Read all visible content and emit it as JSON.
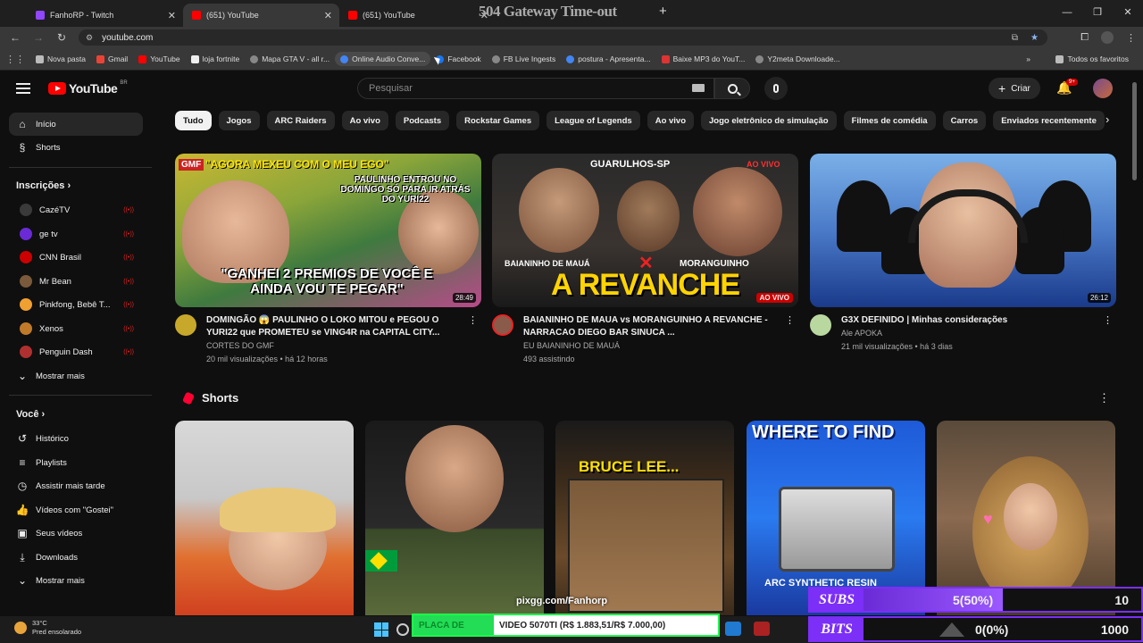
{
  "browser": {
    "tabs": [
      {
        "title": "FanhoRP - Twitch",
        "color": "#9146ff"
      },
      {
        "title": "(651) YouTube",
        "color": "#ff0000"
      },
      {
        "title": "(651) YouTube",
        "color": "#ff0000"
      }
    ],
    "overlay_title": "504 Gateway Time-out",
    "url": "youtube.com",
    "bookmarks": [
      {
        "label": "Nova pasta",
        "icon": "folder-icon"
      },
      {
        "label": "Gmail",
        "icon": "gmail-icon"
      },
      {
        "label": "YouTube",
        "icon": "youtube-icon"
      },
      {
        "label": "loja fortnite",
        "icon": "fortnite-icon"
      },
      {
        "label": "Mapa GTA V - all r...",
        "icon": "globe-icon"
      },
      {
        "label": "Online Audio Conve...",
        "icon": "audio-icon"
      },
      {
        "label": "Facebook",
        "icon": "facebook-icon"
      },
      {
        "label": "FB Live Ingests",
        "icon": "globe-icon"
      },
      {
        "label": "postura - Apresenta...",
        "icon": "slides-icon"
      },
      {
        "label": "Baixe MP3 do YouT...",
        "icon": "download-icon"
      },
      {
        "label": "Y2meta Downloade...",
        "icon": "globe-icon"
      }
    ],
    "all_bookmarks": "Todos os favoritos"
  },
  "yt": {
    "logo_country": "BR",
    "search_placeholder": "Pesquisar",
    "create_label": "Criar",
    "notif_count": "9+"
  },
  "sidebar": {
    "main": [
      {
        "label": "Início",
        "icon": "home-icon"
      },
      {
        "label": "Shorts",
        "icon": "shorts-icon"
      }
    ],
    "subs_heading": "Inscrições",
    "subs": [
      {
        "label": "CazéTV",
        "color": "#3a3a3a"
      },
      {
        "label": "ge tv",
        "color": "#6a2bd6"
      },
      {
        "label": "CNN Brasil",
        "color": "#cc0000"
      },
      {
        "label": "Mr Bean",
        "color": "#7a5a3a"
      },
      {
        "label": "Pinkfong, Bebê T...",
        "color": "#f0a030"
      },
      {
        "label": "Xenos",
        "color": "#c07a2a"
      },
      {
        "label": "Penguin Dash",
        "color": "#b03030"
      }
    ],
    "subs_more": "Mostrar mais",
    "you_heading": "Você",
    "you": [
      {
        "label": "Histórico",
        "icon": "history-icon"
      },
      {
        "label": "Playlists",
        "icon": "playlist-icon"
      },
      {
        "label": "Assistir mais tarde",
        "icon": "clock-icon"
      },
      {
        "label": "Vídeos com \"Gostei\"",
        "icon": "like-icon"
      },
      {
        "label": "Seus vídeos",
        "icon": "video-icon"
      },
      {
        "label": "Downloads",
        "icon": "download-icon"
      }
    ],
    "you_more": "Mostrar mais"
  },
  "chips": [
    "Tudo",
    "Jogos",
    "ARC Raiders",
    "Ao vivo",
    "Podcasts",
    "Rockstar Games",
    "League of Legends",
    "Ao vivo",
    "Jogo eletrônico de simulação",
    "Filmes de comédia",
    "Carros",
    "Enviados recentemente"
  ],
  "videos": [
    {
      "title": "DOMINGÃO 😱 PAULINHO O LOKO MITOU e PEGOU O YURI22 que PROMETEU se VING4R na CAPITAL CITY...",
      "channel": "CORTES DO GMF",
      "stats": "20 mil visualizações • há 12 horas",
      "badge": "28:49",
      "thumb_top": "\"AGORA MEXEU COM O MEU EGO\"",
      "thumb_mid": "PAULINHO ENTROU NO DOMINGO SÓ PARA IR ATRÁS DO YURI22",
      "thumb_bottom": "\"GANHEI 2 PREMIOS DE VOCÊ E AINDA VOU TE PEGAR\"",
      "thumb_logo": "GMF"
    },
    {
      "title": "BAIANINHO DE MAUA vs MORANGUINHO A REVANCHE -NARRACAO DIEGO BAR SINUCA ...",
      "channel": "EU BAIANINHO DE MAUÁ",
      "stats": "493 assistindo",
      "badge": "AO VIVO",
      "thumb_top": "GUARULHOS-SP",
      "thumb_live": "AO VIVO",
      "thumb_left": "BAIANINHO DE MAUÁ",
      "thumb_right": "MORANGUINHO",
      "thumb_big": "A REVANCHE"
    },
    {
      "title": "G3X DEFINIDO | Minhas considerações",
      "channel": "Ale APOKA",
      "stats": "21 mil visualizações • há 3 dias",
      "badge": "26:12"
    }
  ],
  "shorts": {
    "heading": "Shorts",
    "items": [
      {
        "overlay": ""
      },
      {
        "overlay": ""
      },
      {
        "overlay": "BRUCE LEE..."
      },
      {
        "overlay": "WHERE TO FIND",
        "sub": "ARC SYNTHETIC RESIN"
      },
      {
        "overlay": ""
      }
    ]
  },
  "stream_overlay": {
    "pix": "pixgg.com/Fanhorp",
    "ticker_label": "PLACA DE",
    "ticker_text": "VIDEO 5070TI (R$ 1.883,51/R$ 7.000,00)",
    "subs_tag": "SUBS",
    "subs_value": "5(50%)",
    "subs_goal": "10",
    "subs_fraction": 0.5,
    "bits_tag": "BITS",
    "bits_value": "0(0%)",
    "bits_goal": "1000",
    "bits_fraction": 0.0
  },
  "taskbar": {
    "temp": "33°C",
    "weather": "Pred ensolarado"
  }
}
